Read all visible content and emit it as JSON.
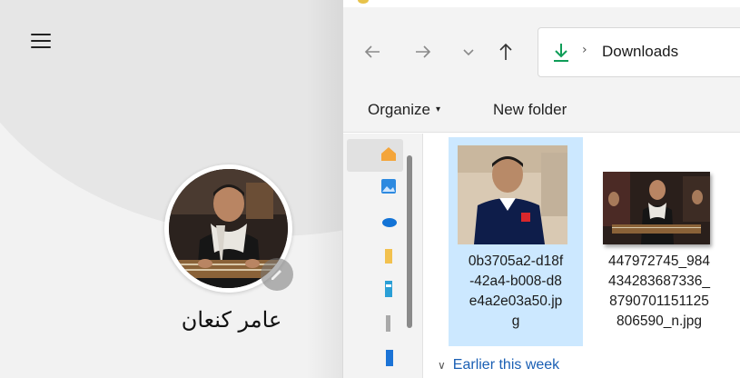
{
  "profile": {
    "name": "عامر كنعان",
    "menu_icon": "hamburger-icon",
    "edit_icon": "pencil-icon"
  },
  "dialog": {
    "nav": {
      "back_icon": "arrow-left-icon",
      "forward_icon": "arrow-right-icon",
      "recent_icon": "chevron-down-icon",
      "up_icon": "arrow-up-icon"
    },
    "address": {
      "icon": "download-icon",
      "separator": "›",
      "location": "Downloads"
    },
    "toolbar": {
      "organize_label": "Organize",
      "organize_caret": "▾",
      "new_folder_label": "New folder"
    },
    "navigation_pane": {
      "icons": [
        "home-icon",
        "gallery-icon",
        "onedrive-icon",
        "folder-icon",
        "desktop-icon",
        "document-icon",
        "downloads-icon"
      ]
    },
    "files": [
      {
        "name_lines": [
          "0b3705a2-d18f",
          "-42a4-b008-d8",
          "e4a2e03a50.jp",
          "g"
        ],
        "selected": true
      },
      {
        "name_lines": [
          "447972745_984",
          "434283687336_",
          "8790701151125",
          "806590_n.jpg"
        ],
        "selected": false
      }
    ],
    "group_header": "Earlier this week",
    "colors": {
      "selection": "#cce8ff",
      "link": "#1a5fb4",
      "download_accent": "#0f9d58"
    }
  }
}
